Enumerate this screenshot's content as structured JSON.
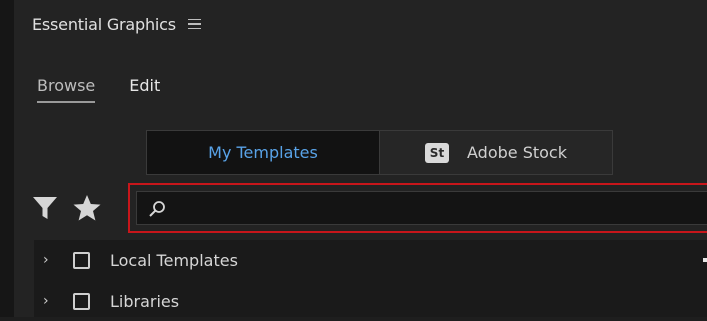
{
  "panel": {
    "title": "Essential Graphics",
    "menu_icon": "hamburger-menu-icon"
  },
  "tabs": [
    {
      "label": "Browse",
      "active": true
    },
    {
      "label": "Edit",
      "active": false
    }
  ],
  "source_toggle": {
    "options": [
      {
        "label": "My Templates",
        "active": true
      },
      {
        "label": "Adobe Stock",
        "badge": "St",
        "active": false
      }
    ]
  },
  "filter": {
    "filter_icon": "funnel-icon",
    "favorites_icon": "star-icon"
  },
  "search": {
    "placeholder": "",
    "value": "",
    "icon": "search-icon"
  },
  "tree": {
    "items": [
      {
        "label": "Local Templates",
        "checked": false
      },
      {
        "label": "Libraries",
        "checked": false
      }
    ],
    "add_icon": "plus-icon"
  },
  "colors": {
    "accent": "#59a3e8",
    "highlight_outline": "#c8161b",
    "panel_bg": "#232323"
  }
}
